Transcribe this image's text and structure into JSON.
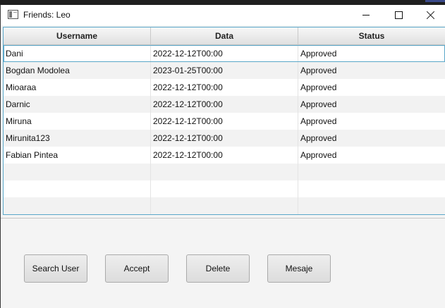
{
  "window": {
    "title": "Friends: Leo"
  },
  "table": {
    "columns": [
      "Username",
      "Data",
      "Status"
    ],
    "rows": [
      {
        "username": "Dani",
        "data": "2022-12-12T00:00",
        "status": "Approved"
      },
      {
        "username": "Bogdan Modolea",
        "data": "2023-01-25T00:00",
        "status": "Approved"
      },
      {
        "username": "Mioaraa",
        "data": "2022-12-12T00:00",
        "status": "Approved"
      },
      {
        "username": "Darnic",
        "data": "2022-12-12T00:00",
        "status": "Approved"
      },
      {
        "username": "Miruna",
        "data": "2022-12-12T00:00",
        "status": "Approved"
      },
      {
        "username": "Mirunita123",
        "data": "2022-12-12T00:00",
        "status": "Approved"
      },
      {
        "username": "Fabian Pintea",
        "data": "2022-12-12T00:00",
        "status": "Approved"
      }
    ]
  },
  "buttons": {
    "search_user": "Search User",
    "accept": "Accept",
    "delete": "Delete",
    "mesaje": "Mesaje"
  },
  "colors": {
    "selection_border": "#5aa7c9",
    "window_bg": "#f4f4f4"
  }
}
